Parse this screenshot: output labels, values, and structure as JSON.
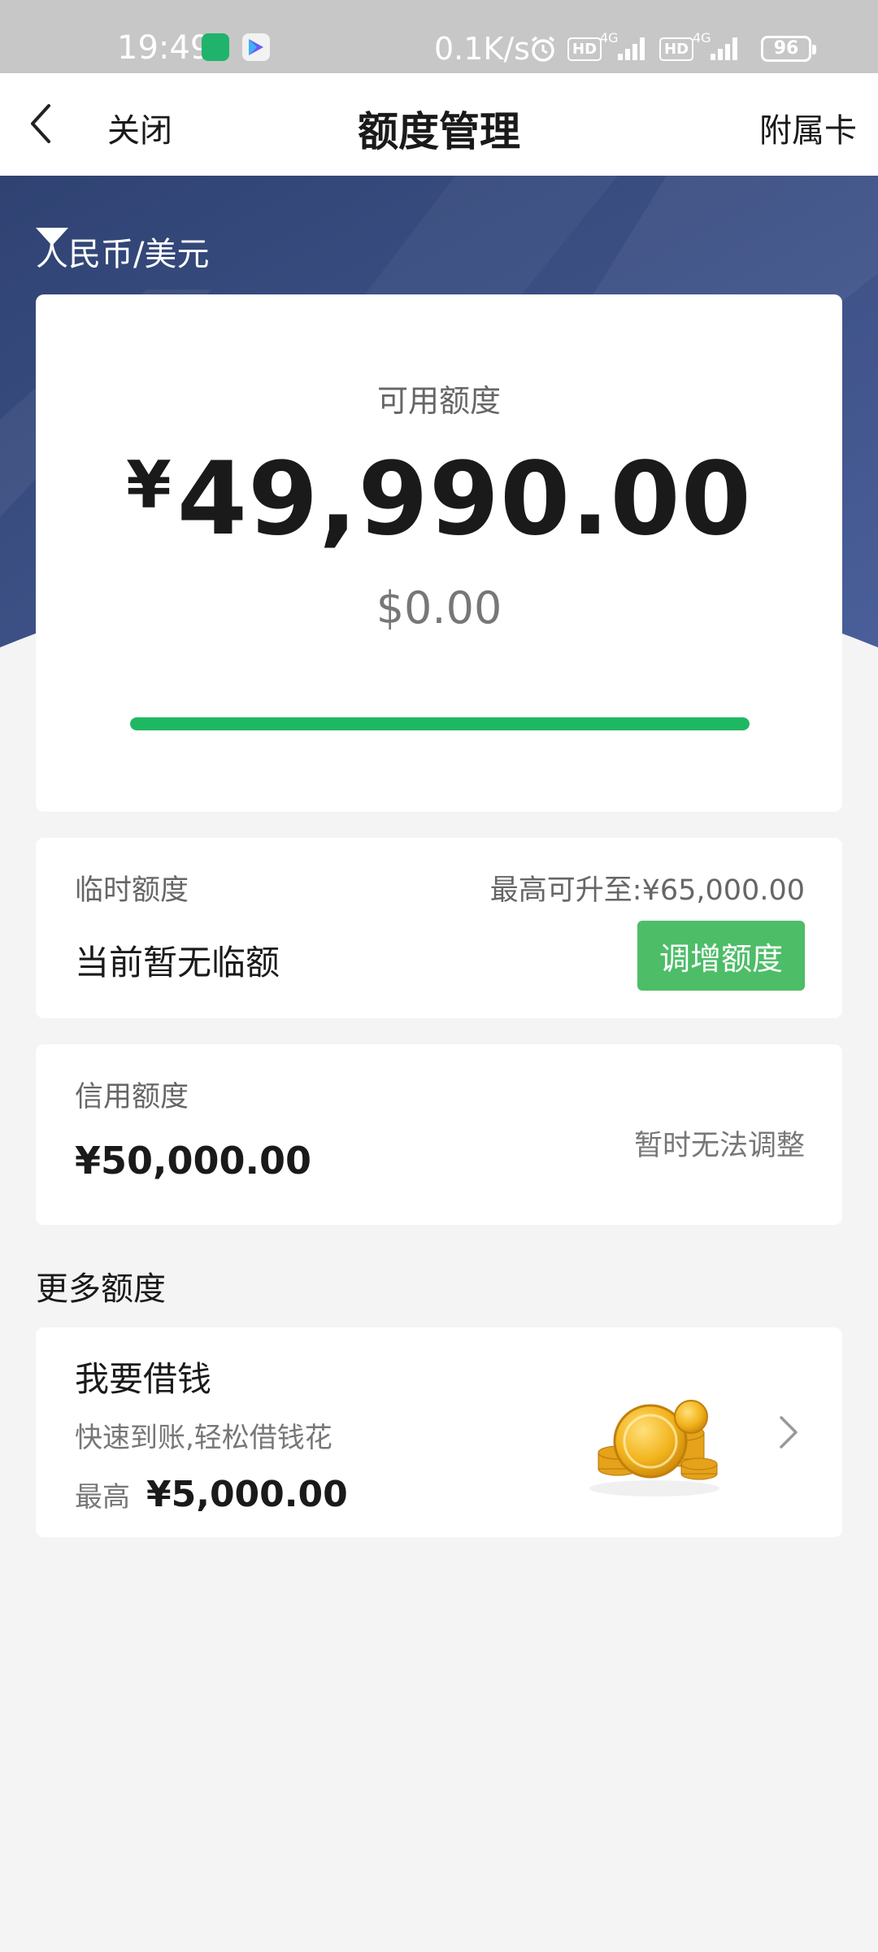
{
  "status_bar": {
    "time": "19:49",
    "speed": "0.1K/s",
    "hd": "HD",
    "net": "4G",
    "battery": "96"
  },
  "nav": {
    "close": "关闭",
    "title": "额度管理",
    "sub_card": "附属卡"
  },
  "currency": {
    "selected": "人民币/美元"
  },
  "available": {
    "label": "可用额度",
    "symbol": "¥",
    "amount": "49,990.00",
    "usd": "$0.00",
    "usage_ratio": 0.9998,
    "bar_color": "#1fb862"
  },
  "temporary": {
    "title": "临时额度",
    "max_label": "最高可升至:¥65,000.00",
    "status": "当前暂无临额",
    "button": "调增额度",
    "button_color": "#4dbd68"
  },
  "credit": {
    "title": "信用额度",
    "value": "¥50,000.00",
    "note": "暂时无法调整"
  },
  "more": {
    "section_title": "更多额度"
  },
  "loan": {
    "title": "我要借钱",
    "subtitle": "快速到账,轻松借钱花",
    "max_label": "最高",
    "max_amount": "¥5,000.00"
  },
  "colors": {
    "hero_bg": "#3a4f86",
    "page_bg": "#f4f4f4"
  }
}
